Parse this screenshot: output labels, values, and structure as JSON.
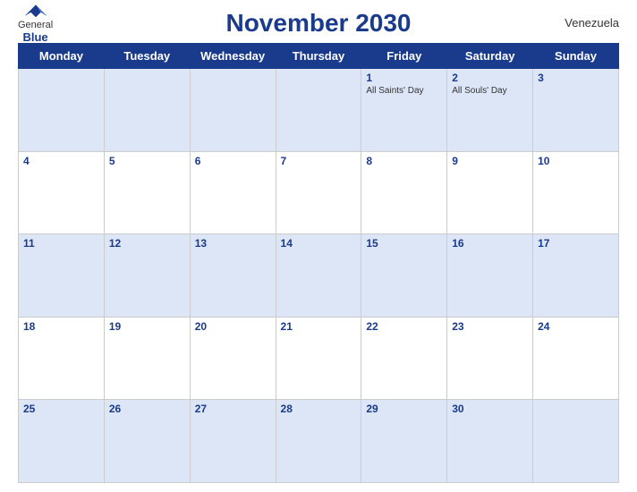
{
  "header": {
    "logo_general": "General",
    "logo_blue": "Blue",
    "title": "November 2030",
    "country": "Venezuela"
  },
  "days_of_week": [
    "Monday",
    "Tuesday",
    "Wednesday",
    "Thursday",
    "Friday",
    "Saturday",
    "Sunday"
  ],
  "weeks": [
    [
      {
        "day": "",
        "holiday": ""
      },
      {
        "day": "",
        "holiday": ""
      },
      {
        "day": "",
        "holiday": ""
      },
      {
        "day": "",
        "holiday": ""
      },
      {
        "day": "1",
        "holiday": "All Saints' Day"
      },
      {
        "day": "2",
        "holiday": "All Souls' Day"
      },
      {
        "day": "3",
        "holiday": ""
      }
    ],
    [
      {
        "day": "4",
        "holiday": ""
      },
      {
        "day": "5",
        "holiday": ""
      },
      {
        "day": "6",
        "holiday": ""
      },
      {
        "day": "7",
        "holiday": ""
      },
      {
        "day": "8",
        "holiday": ""
      },
      {
        "day": "9",
        "holiday": ""
      },
      {
        "day": "10",
        "holiday": ""
      }
    ],
    [
      {
        "day": "11",
        "holiday": ""
      },
      {
        "day": "12",
        "holiday": ""
      },
      {
        "day": "13",
        "holiday": ""
      },
      {
        "day": "14",
        "holiday": ""
      },
      {
        "day": "15",
        "holiday": ""
      },
      {
        "day": "16",
        "holiday": ""
      },
      {
        "day": "17",
        "holiday": ""
      }
    ],
    [
      {
        "day": "18",
        "holiday": ""
      },
      {
        "day": "19",
        "holiday": ""
      },
      {
        "day": "20",
        "holiday": ""
      },
      {
        "day": "21",
        "holiday": ""
      },
      {
        "day": "22",
        "holiday": ""
      },
      {
        "day": "23",
        "holiday": ""
      },
      {
        "day": "24",
        "holiday": ""
      }
    ],
    [
      {
        "day": "25",
        "holiday": ""
      },
      {
        "day": "26",
        "holiday": ""
      },
      {
        "day": "27",
        "holiday": ""
      },
      {
        "day": "28",
        "holiday": ""
      },
      {
        "day": "29",
        "holiday": ""
      },
      {
        "day": "30",
        "holiday": ""
      },
      {
        "day": "",
        "holiday": ""
      }
    ]
  ]
}
